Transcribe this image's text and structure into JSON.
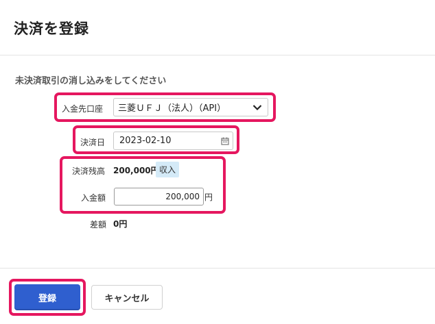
{
  "dialog": {
    "title": "決済を登録",
    "instruction": "未決済取引の消し込みをしてください"
  },
  "form": {
    "bank_account": {
      "label": "入金先口座",
      "value": "三菱ＵＦＪ（法人）（API）"
    },
    "settlement_date": {
      "label": "決済日",
      "value": "2023-02-10"
    },
    "balance": {
      "label": "決済残高",
      "value": "200,000円",
      "badge": "収入"
    },
    "deposit_amount": {
      "label": "入金額",
      "value": "200,000",
      "unit": "円"
    },
    "difference": {
      "label": "差額",
      "value": "0円"
    }
  },
  "buttons": {
    "register": "登録",
    "cancel": "キャンセル"
  },
  "colors": {
    "highlight": "#e5175f",
    "primary": "#2f5fcf",
    "badge_bg": "#d4eaf7"
  }
}
